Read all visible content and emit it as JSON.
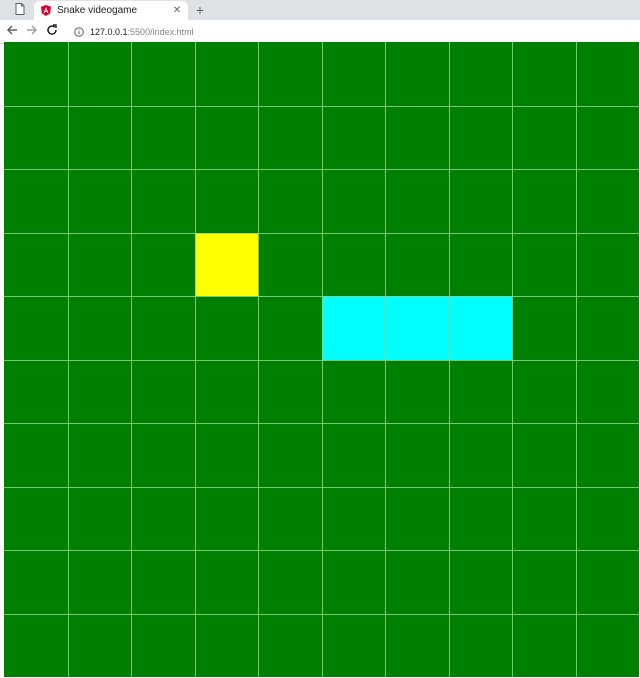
{
  "tabs": {
    "active_title": "Snake videogame",
    "close_glyph": "✕",
    "new_tab_glyph": "+"
  },
  "toolbar": {
    "url_host": "127.0.0.1",
    "url_path": ":5500/index.html"
  },
  "icons": {
    "blank_tab": "page-icon",
    "favicon": "angular-icon",
    "back": "back-arrow-icon",
    "forward": "forward-arrow-icon",
    "reload": "reload-icon",
    "info": "info-icon"
  },
  "game": {
    "grid_size": 10,
    "board_color": "#008000",
    "grid_line_color": "#8fd18f",
    "food": {
      "col": 3,
      "row": 3,
      "color": "#ffff00"
    },
    "snake": {
      "color": "#00ffff",
      "cells": [
        {
          "col": 5,
          "row": 4
        },
        {
          "col": 6,
          "row": 4
        },
        {
          "col": 7,
          "row": 4
        }
      ]
    }
  }
}
